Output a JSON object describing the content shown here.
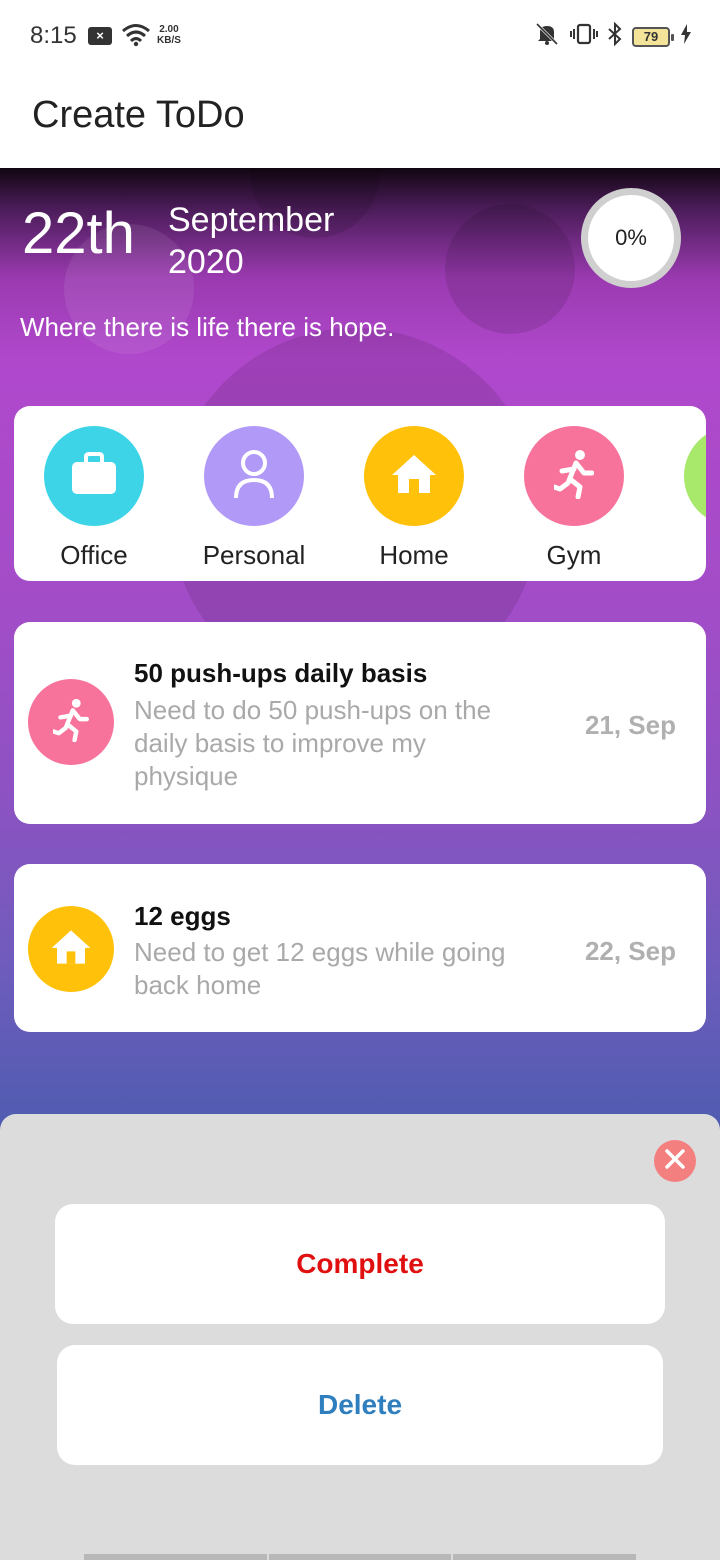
{
  "status_bar": {
    "time": "8:15",
    "speed_value": "2.00",
    "speed_unit": "KB/S",
    "battery": "79"
  },
  "app_bar": {
    "title": "Create ToDo"
  },
  "header": {
    "day": "22th",
    "month": "September",
    "year": "2020",
    "progress": "0%",
    "quote": "Where there is life there is hope."
  },
  "categories": [
    {
      "label": "Office",
      "icon": "briefcase-icon",
      "color": "#3dd4e8"
    },
    {
      "label": "Personal",
      "icon": "person-icon",
      "color": "#b19af7"
    },
    {
      "label": "Home",
      "icon": "home-icon",
      "color": "#ffc10a"
    },
    {
      "label": "Gym",
      "icon": "runner-icon",
      "color": "#f7739b"
    },
    {
      "label": "",
      "icon": "category-icon",
      "color": "#a8e86a"
    }
  ],
  "todos": [
    {
      "title": "50 push-ups daily basis",
      "description": "Need to do 50 push-ups on the daily basis to improve my physique",
      "date": "21, Sep",
      "icon": "runner-icon",
      "color": "#f7739b"
    },
    {
      "title": "12 eggs",
      "description": "Need to get 12 eggs while going back home",
      "date": "22, Sep",
      "icon": "home-icon",
      "color": "#ffc10a"
    }
  ],
  "sheet": {
    "complete_label": "Complete",
    "delete_label": "Delete",
    "complete_color": "#e01010",
    "delete_color": "#2f7fbf",
    "close_color": "#f47f7f"
  }
}
